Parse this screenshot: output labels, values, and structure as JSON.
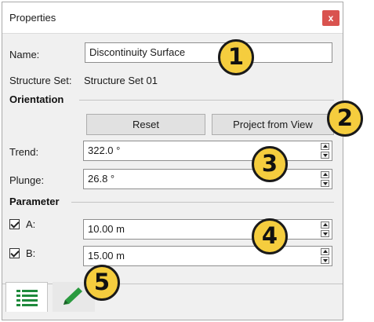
{
  "window": {
    "title": "Properties",
    "close_label": "x"
  },
  "fields": {
    "name_label": "Name:",
    "name_value": "Discontinuity Surface",
    "structure_set_label": "Structure Set:",
    "structure_set_value": "Structure Set 01"
  },
  "orientation": {
    "header": "Orientation",
    "reset_label": "Reset",
    "project_label": "Project from View",
    "trend_label": "Trend:",
    "trend_value": "322.0 °",
    "plunge_label": "Plunge:",
    "plunge_value": "26.8 °"
  },
  "parameter": {
    "header": "Parameter",
    "a_label": "A:",
    "a_value": "10.00 m",
    "a_checked": true,
    "b_label": "B:",
    "b_value": "15.00 m",
    "b_checked": true
  },
  "tabs": [
    {
      "icon": "list-icon",
      "active": true
    },
    {
      "icon": "pencil-icon",
      "active": false
    }
  ],
  "callouts": [
    "1",
    "2",
    "3",
    "4",
    "5"
  ],
  "colors": {
    "callout_fill": "#f5cd3e",
    "close_button": "#d9534f",
    "tab_icon": "#1e8a3c"
  }
}
